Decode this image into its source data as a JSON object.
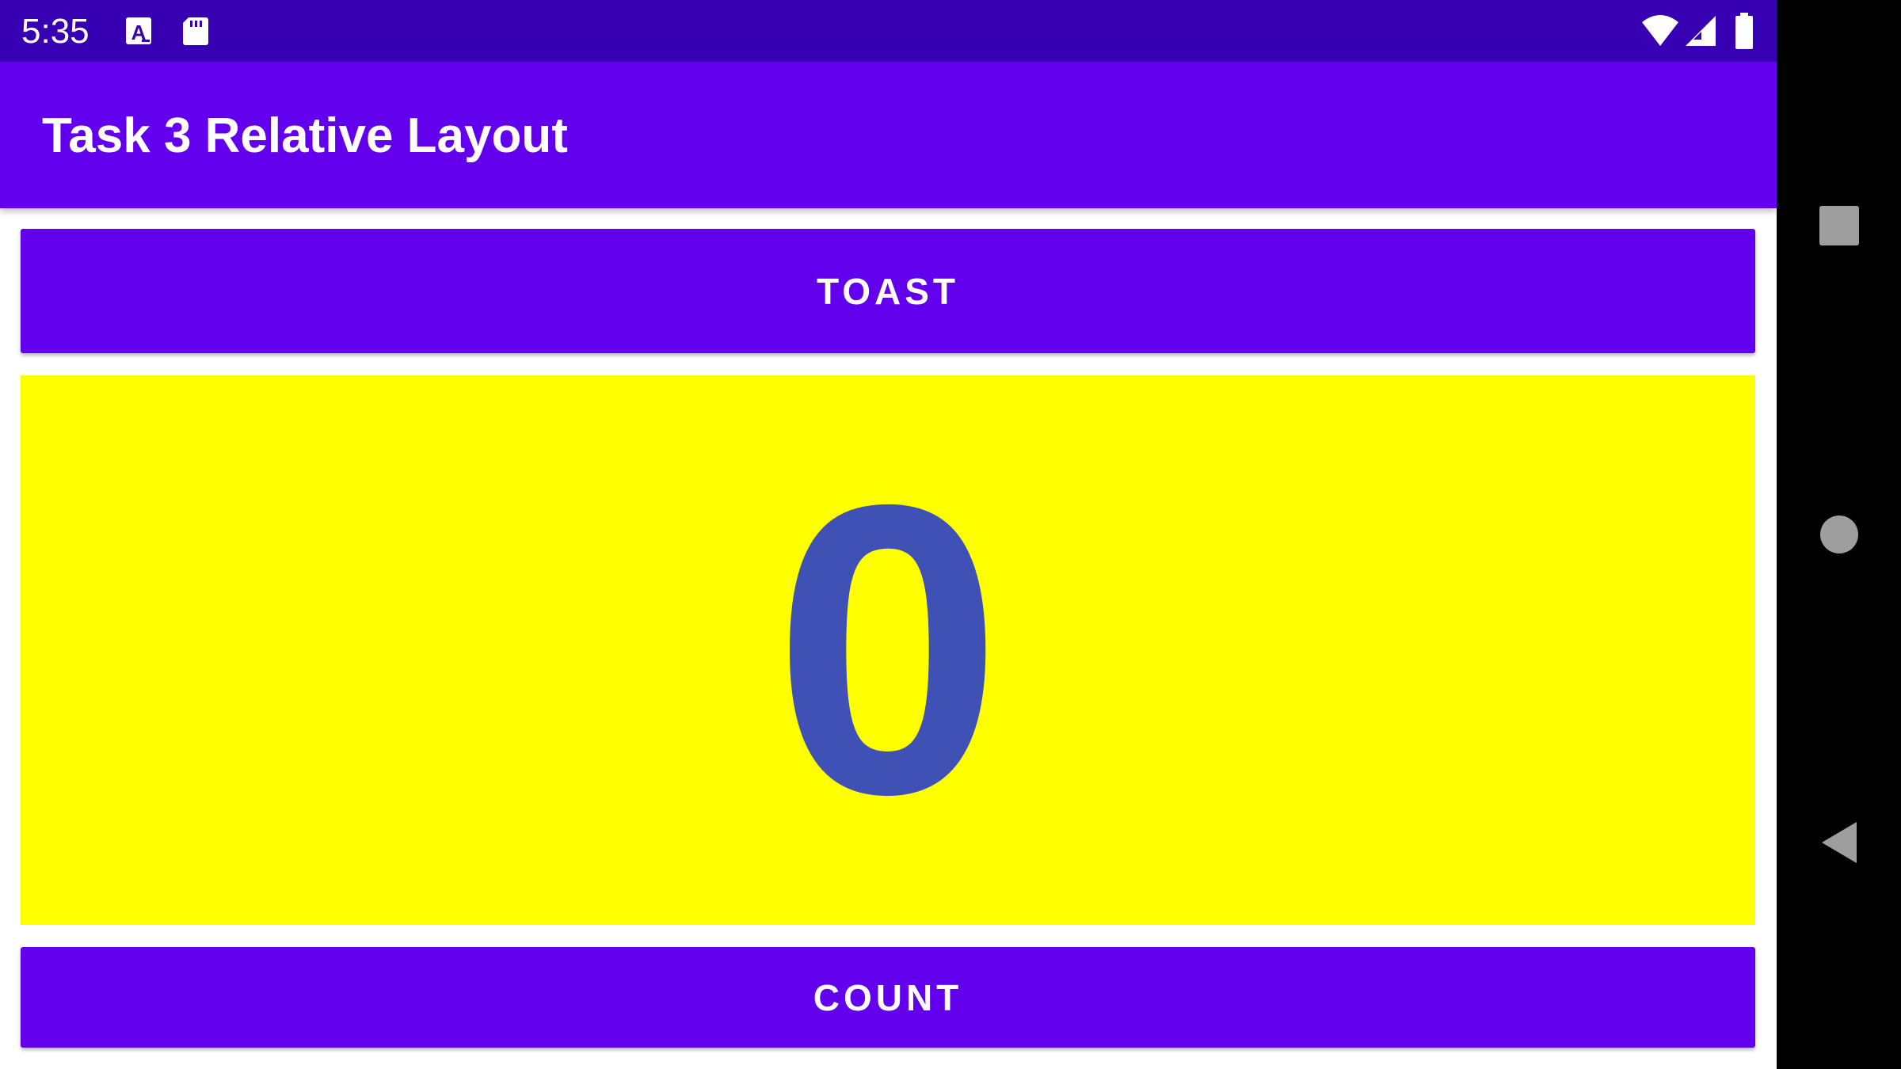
{
  "status_bar": {
    "time": "5:35",
    "left_icons": [
      "a-badge-icon",
      "sd-card-icon"
    ],
    "right_icons": [
      "wifi-icon",
      "cell-signal-icon",
      "battery-icon"
    ],
    "background": "#3700b3"
  },
  "app_bar": {
    "title": "Task 3 Relative Layout",
    "background": "#6200ee"
  },
  "main": {
    "toast_button_label": "TOAST",
    "count_value": "0",
    "count_button_label": "COUNT",
    "count_panel_color": "#ffff00",
    "count_text_color": "#3f51b5"
  },
  "nav_bar": {
    "items": [
      "recents-square-icon",
      "home-circle-icon",
      "back-triangle-icon"
    ]
  }
}
